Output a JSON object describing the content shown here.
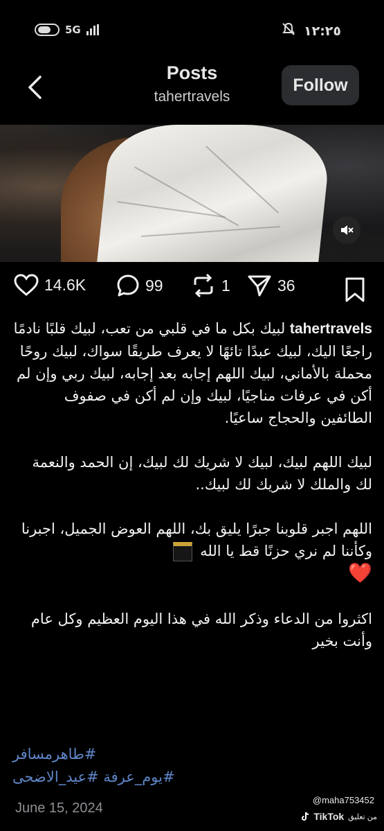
{
  "status_bar": {
    "network": "5G",
    "time": "١٢:٢٥"
  },
  "header": {
    "title": "Posts",
    "username": "tahertravels",
    "follow_label": "Follow"
  },
  "actions": {
    "likes": "14.6K",
    "comments": "99",
    "reposts": "1",
    "shares": "36"
  },
  "caption": {
    "username": "tahertravels",
    "paragraph1": "لبيك بكل ما في قلبي من تعب، لبيك قلبًا نادمًا راجعًا اليك، لبيك عبدًا تائهًا لا يعرف طريقًا سواك، لبيك روحًا محملة بالأماني، لبيك اللهم إجابه بعد إجابه، لبيك ربي وإن لم أكن في عرفات مناجيًا، لبيك وإن لم أكن في صفوف الطائفين والحجاج ساعيًا.",
    "paragraph2": "لبيك اللهم لبيك، لبيك لا شريك لك لبيك، إن الحمد والنعمة لك والملك لا شريك لك لبيك..",
    "paragraph3": "اللهم اجبر قلوبنا جبرًا يليق بك، اللهم العوض الجميل، اجبرنا وكأننا لم نري حزنًا قط يا الله",
    "heart": "❤️",
    "paragraph4": "اكثروا من الدعاء وذكر الله في هذا اليوم العظيم وكل عام وأنت بخير"
  },
  "hashtags": {
    "line1": "#طاهرمسافر",
    "line2": "#يوم_عرفة #عيد_الاضحى"
  },
  "date": "June 15, 2024",
  "watermark": {
    "user": "@maha753452",
    "brand": "TikTok",
    "sub": "من تعليق"
  }
}
